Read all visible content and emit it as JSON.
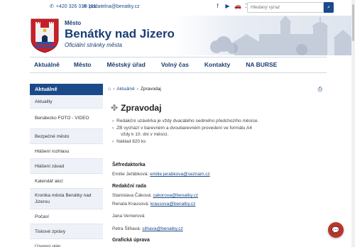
{
  "topbar": {
    "phone": "+420 326 316 101",
    "email": "podatelna@benatky.cz",
    "icons": [
      "phone-icon",
      "mail-icon",
      "facebook-icon",
      "youtube-icon",
      "car-icon",
      "sitemap-icon"
    ],
    "search_placeholder": "Hledaný výraz"
  },
  "header": {
    "mesto": "Město",
    "city": "Benátky nad Jizerou",
    "subtitle": "Oficiální stránky města"
  },
  "nav": {
    "items": [
      "Aktuálně",
      "Město",
      "Městský úřad",
      "Volný čas",
      "Kontakty",
      "NA BURSE"
    ]
  },
  "sidebar": {
    "head": "Aktuálně",
    "items": [
      "Aktuality",
      "Benátecko FOTO - VIDEO",
      "Bezpečné město",
      "Hlášení rozhlasu",
      "Hlášení závad",
      "Kalendář akcí",
      "Kronika města Benátky nad Jizerou",
      "Počasí",
      "Tiskové zprávy",
      "Územní plán"
    ]
  },
  "breadcrumb": {
    "home_icon": "home-icon",
    "sep": "›",
    "level1": "Aktuálně",
    "current": "Zpravodaj"
  },
  "page": {
    "title": "Zpravodaj",
    "bullets": [
      "Redakční uzávěrka je vždy dvacátého sedmého předchozího měsíce.",
      "ZB vychází v barevném a dvoubarevném provedení ve formátu A4",
      "vždy k 10. dni v měsíci.",
      "Náklad 820 ks"
    ],
    "sefredaktorka_title": "Šéfredaktorka",
    "sefredaktorka_name": "Emilie Jeřábková:",
    "sefredaktorka_mail": "emilie.jerabkova@seznam.cz",
    "rada_title": "Redakční rada",
    "rada_1_name": "Stanislava Čáková:",
    "rada_1_mail": "cakorova@benatky.cz",
    "rada_2_name": "Renata Krausová:",
    "rada_2_mail": "krausova@benatky.cz",
    "rada_3_name": "Jana Vernerová",
    "rada_4_name": "Petra Šilhavá:",
    "rada_4_mail": "silhava@benatky.cz",
    "graficka_title": "Grafická úprava"
  },
  "colors": {
    "brand": "#1a4a8a",
    "brand_dark": "#1a3d73",
    "chat": "#b8352c"
  }
}
